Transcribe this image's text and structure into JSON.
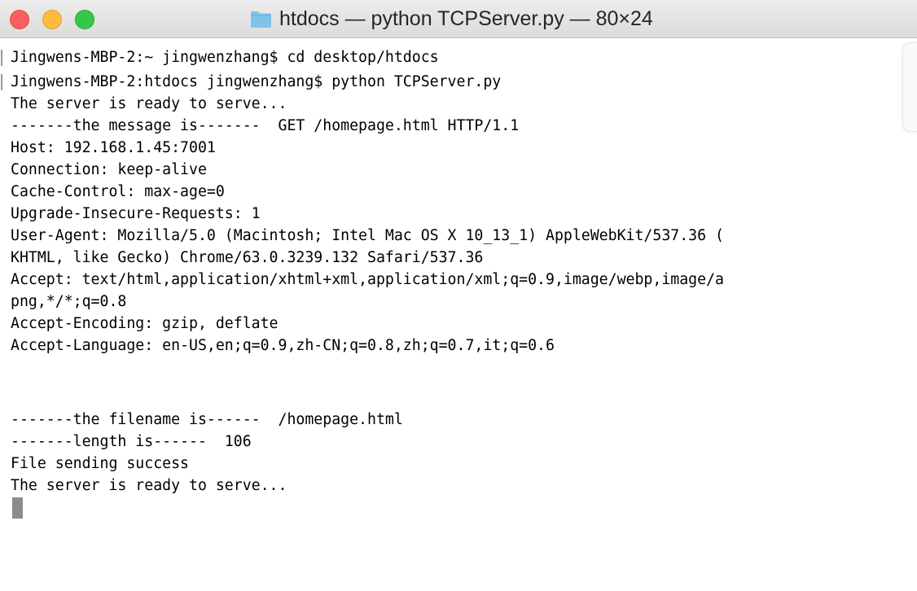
{
  "window": {
    "title": "htdocs — python TCPServer.py — 80×24",
    "colors": {
      "close": "#fc605c",
      "minimize": "#fdbc40",
      "zoom": "#34c84a",
      "folder": "#7fc3ea"
    }
  },
  "terminal": {
    "lines": [
      "Jingwens-MBP-2:~ jingwenzhang$ cd desktop/htdocs",
      "Jingwens-MBP-2:htdocs jingwenzhang$ python TCPServer.py",
      "The server is ready to serve...",
      "-------the message is-------  GET /homepage.html HTTP/1.1",
      "Host: 192.168.1.45:7001",
      "Connection: keep-alive",
      "Cache-Control: max-age=0",
      "Upgrade-Insecure-Requests: 1",
      "User-Agent: Mozilla/5.0 (Macintosh; Intel Mac OS X 10_13_1) AppleWebKit/537.36 (",
      "KHTML, like Gecko) Chrome/63.0.3239.132 Safari/537.36",
      "Accept: text/html,application/xhtml+xml,application/xml;q=0.9,image/webp,image/a",
      "png,*/*;q=0.8",
      "Accept-Encoding: gzip, deflate",
      "Accept-Language: en-US,en;q=0.9,zh-CN;q=0.8,zh;q=0.7,it;q=0.6",
      "",
      "",
      "-------the filename is------  /homepage.html",
      "-------length is------  106",
      "File sending success",
      "The server is ready to serve..."
    ]
  }
}
